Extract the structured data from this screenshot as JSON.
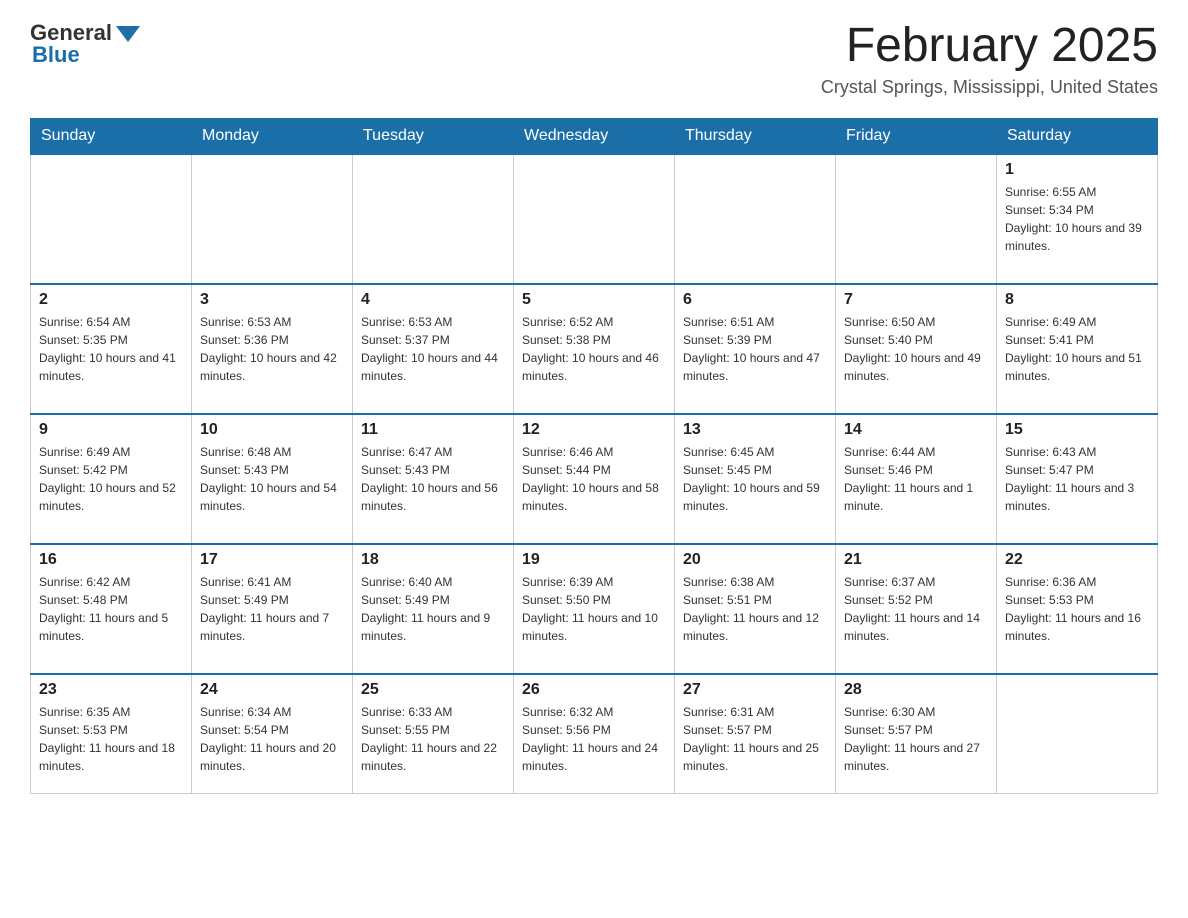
{
  "logo": {
    "text_general": "General",
    "text_blue": "Blue"
  },
  "header": {
    "month_year": "February 2025",
    "location": "Crystal Springs, Mississippi, United States"
  },
  "weekdays": [
    "Sunday",
    "Monday",
    "Tuesday",
    "Wednesday",
    "Thursday",
    "Friday",
    "Saturday"
  ],
  "weeks": [
    [
      {
        "day": "",
        "sunrise": "",
        "sunset": "",
        "daylight": "",
        "empty": true
      },
      {
        "day": "",
        "sunrise": "",
        "sunset": "",
        "daylight": "",
        "empty": true
      },
      {
        "day": "",
        "sunrise": "",
        "sunset": "",
        "daylight": "",
        "empty": true
      },
      {
        "day": "",
        "sunrise": "",
        "sunset": "",
        "daylight": "",
        "empty": true
      },
      {
        "day": "",
        "sunrise": "",
        "sunset": "",
        "daylight": "",
        "empty": true
      },
      {
        "day": "",
        "sunrise": "",
        "sunset": "",
        "daylight": "",
        "empty": true
      },
      {
        "day": "1",
        "sunrise": "Sunrise: 6:55 AM",
        "sunset": "Sunset: 5:34 PM",
        "daylight": "Daylight: 10 hours and 39 minutes.",
        "empty": false
      }
    ],
    [
      {
        "day": "2",
        "sunrise": "Sunrise: 6:54 AM",
        "sunset": "Sunset: 5:35 PM",
        "daylight": "Daylight: 10 hours and 41 minutes.",
        "empty": false
      },
      {
        "day": "3",
        "sunrise": "Sunrise: 6:53 AM",
        "sunset": "Sunset: 5:36 PM",
        "daylight": "Daylight: 10 hours and 42 minutes.",
        "empty": false
      },
      {
        "day": "4",
        "sunrise": "Sunrise: 6:53 AM",
        "sunset": "Sunset: 5:37 PM",
        "daylight": "Daylight: 10 hours and 44 minutes.",
        "empty": false
      },
      {
        "day": "5",
        "sunrise": "Sunrise: 6:52 AM",
        "sunset": "Sunset: 5:38 PM",
        "daylight": "Daylight: 10 hours and 46 minutes.",
        "empty": false
      },
      {
        "day": "6",
        "sunrise": "Sunrise: 6:51 AM",
        "sunset": "Sunset: 5:39 PM",
        "daylight": "Daylight: 10 hours and 47 minutes.",
        "empty": false
      },
      {
        "day": "7",
        "sunrise": "Sunrise: 6:50 AM",
        "sunset": "Sunset: 5:40 PM",
        "daylight": "Daylight: 10 hours and 49 minutes.",
        "empty": false
      },
      {
        "day": "8",
        "sunrise": "Sunrise: 6:49 AM",
        "sunset": "Sunset: 5:41 PM",
        "daylight": "Daylight: 10 hours and 51 minutes.",
        "empty": false
      }
    ],
    [
      {
        "day": "9",
        "sunrise": "Sunrise: 6:49 AM",
        "sunset": "Sunset: 5:42 PM",
        "daylight": "Daylight: 10 hours and 52 minutes.",
        "empty": false
      },
      {
        "day": "10",
        "sunrise": "Sunrise: 6:48 AM",
        "sunset": "Sunset: 5:43 PM",
        "daylight": "Daylight: 10 hours and 54 minutes.",
        "empty": false
      },
      {
        "day": "11",
        "sunrise": "Sunrise: 6:47 AM",
        "sunset": "Sunset: 5:43 PM",
        "daylight": "Daylight: 10 hours and 56 minutes.",
        "empty": false
      },
      {
        "day": "12",
        "sunrise": "Sunrise: 6:46 AM",
        "sunset": "Sunset: 5:44 PM",
        "daylight": "Daylight: 10 hours and 58 minutes.",
        "empty": false
      },
      {
        "day": "13",
        "sunrise": "Sunrise: 6:45 AM",
        "sunset": "Sunset: 5:45 PM",
        "daylight": "Daylight: 10 hours and 59 minutes.",
        "empty": false
      },
      {
        "day": "14",
        "sunrise": "Sunrise: 6:44 AM",
        "sunset": "Sunset: 5:46 PM",
        "daylight": "Daylight: 11 hours and 1 minute.",
        "empty": false
      },
      {
        "day": "15",
        "sunrise": "Sunrise: 6:43 AM",
        "sunset": "Sunset: 5:47 PM",
        "daylight": "Daylight: 11 hours and 3 minutes.",
        "empty": false
      }
    ],
    [
      {
        "day": "16",
        "sunrise": "Sunrise: 6:42 AM",
        "sunset": "Sunset: 5:48 PM",
        "daylight": "Daylight: 11 hours and 5 minutes.",
        "empty": false
      },
      {
        "day": "17",
        "sunrise": "Sunrise: 6:41 AM",
        "sunset": "Sunset: 5:49 PM",
        "daylight": "Daylight: 11 hours and 7 minutes.",
        "empty": false
      },
      {
        "day": "18",
        "sunrise": "Sunrise: 6:40 AM",
        "sunset": "Sunset: 5:49 PM",
        "daylight": "Daylight: 11 hours and 9 minutes.",
        "empty": false
      },
      {
        "day": "19",
        "sunrise": "Sunrise: 6:39 AM",
        "sunset": "Sunset: 5:50 PM",
        "daylight": "Daylight: 11 hours and 10 minutes.",
        "empty": false
      },
      {
        "day": "20",
        "sunrise": "Sunrise: 6:38 AM",
        "sunset": "Sunset: 5:51 PM",
        "daylight": "Daylight: 11 hours and 12 minutes.",
        "empty": false
      },
      {
        "day": "21",
        "sunrise": "Sunrise: 6:37 AM",
        "sunset": "Sunset: 5:52 PM",
        "daylight": "Daylight: 11 hours and 14 minutes.",
        "empty": false
      },
      {
        "day": "22",
        "sunrise": "Sunrise: 6:36 AM",
        "sunset": "Sunset: 5:53 PM",
        "daylight": "Daylight: 11 hours and 16 minutes.",
        "empty": false
      }
    ],
    [
      {
        "day": "23",
        "sunrise": "Sunrise: 6:35 AM",
        "sunset": "Sunset: 5:53 PM",
        "daylight": "Daylight: 11 hours and 18 minutes.",
        "empty": false
      },
      {
        "day": "24",
        "sunrise": "Sunrise: 6:34 AM",
        "sunset": "Sunset: 5:54 PM",
        "daylight": "Daylight: 11 hours and 20 minutes.",
        "empty": false
      },
      {
        "day": "25",
        "sunrise": "Sunrise: 6:33 AM",
        "sunset": "Sunset: 5:55 PM",
        "daylight": "Daylight: 11 hours and 22 minutes.",
        "empty": false
      },
      {
        "day": "26",
        "sunrise": "Sunrise: 6:32 AM",
        "sunset": "Sunset: 5:56 PM",
        "daylight": "Daylight: 11 hours and 24 minutes.",
        "empty": false
      },
      {
        "day": "27",
        "sunrise": "Sunrise: 6:31 AM",
        "sunset": "Sunset: 5:57 PM",
        "daylight": "Daylight: 11 hours and 25 minutes.",
        "empty": false
      },
      {
        "day": "28",
        "sunrise": "Sunrise: 6:30 AM",
        "sunset": "Sunset: 5:57 PM",
        "daylight": "Daylight: 11 hours and 27 minutes.",
        "empty": false
      },
      {
        "day": "",
        "sunrise": "",
        "sunset": "",
        "daylight": "",
        "empty": true
      }
    ]
  ]
}
